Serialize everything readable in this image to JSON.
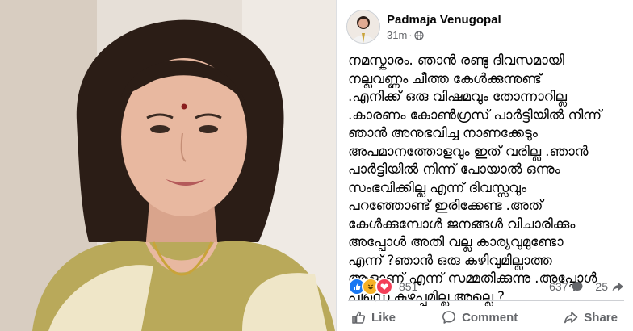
{
  "post": {
    "author": "Padmaja Venugopal",
    "time": "31m",
    "dot": "·",
    "privacy_icon": "globe-icon",
    "text_lines": [
      "നമസ്കാരം. ഞാൻ രണ്ടു ദിവസമായി",
      "നല്ലവണ്ണം ചീത്ത കേൾക്കുന്നുണ്ട്",
      ".എനിക്ക് ഒരു വിഷമവും തോന്നാറില്ല",
      ".കാരണം കോൺഗ്രസ് പാർട്ടിയിൽ നിന്ന്",
      "ഞാൻ അനുഭവിച്ച നാണക്കേടും",
      "അപമാനത്തോളവും ഇത് വരില്ല .ഞാൻ",
      "പാർട്ടിയിൽ നിന്ന് പോയാൽ ഒന്നും",
      "സംഭവിക്കില്ല എന്ന് ദിവസ്സവും",
      "പറഞ്ഞോണ്ട് ഇരിക്കേണ്ട .അത്",
      "കേൾക്കുമ്പോൾ ജനങ്ങൾ വിചാരിക്കും",
      "അപ്പോൾ അതി വല്ല കാര്യവുമുണ്ടോ",
      "എന്ന് ?ഞാൻ ഒരു കഴിവുമില്ലാത്ത",
      "ആളാണ് എന്ന് സമ്മതിക്കുന്നു .അപ്പോൾ",
      "പിന്നെ കുഴപ്പമില്ല അല്ലെ ?"
    ]
  },
  "stats": {
    "reactions_count": "851",
    "reaction_icons": [
      "like-icon",
      "haha-icon",
      "love-icon"
    ],
    "comments_count": "637",
    "shares_count": "25"
  },
  "actions": {
    "like_label": "Like",
    "comment_label": "Comment",
    "share_label": "Share"
  },
  "colors": {
    "like_blue": "#1877f2",
    "love_red": "#f33e58",
    "haha_yellow": "#f7b125",
    "secondary_text": "#65676b"
  }
}
